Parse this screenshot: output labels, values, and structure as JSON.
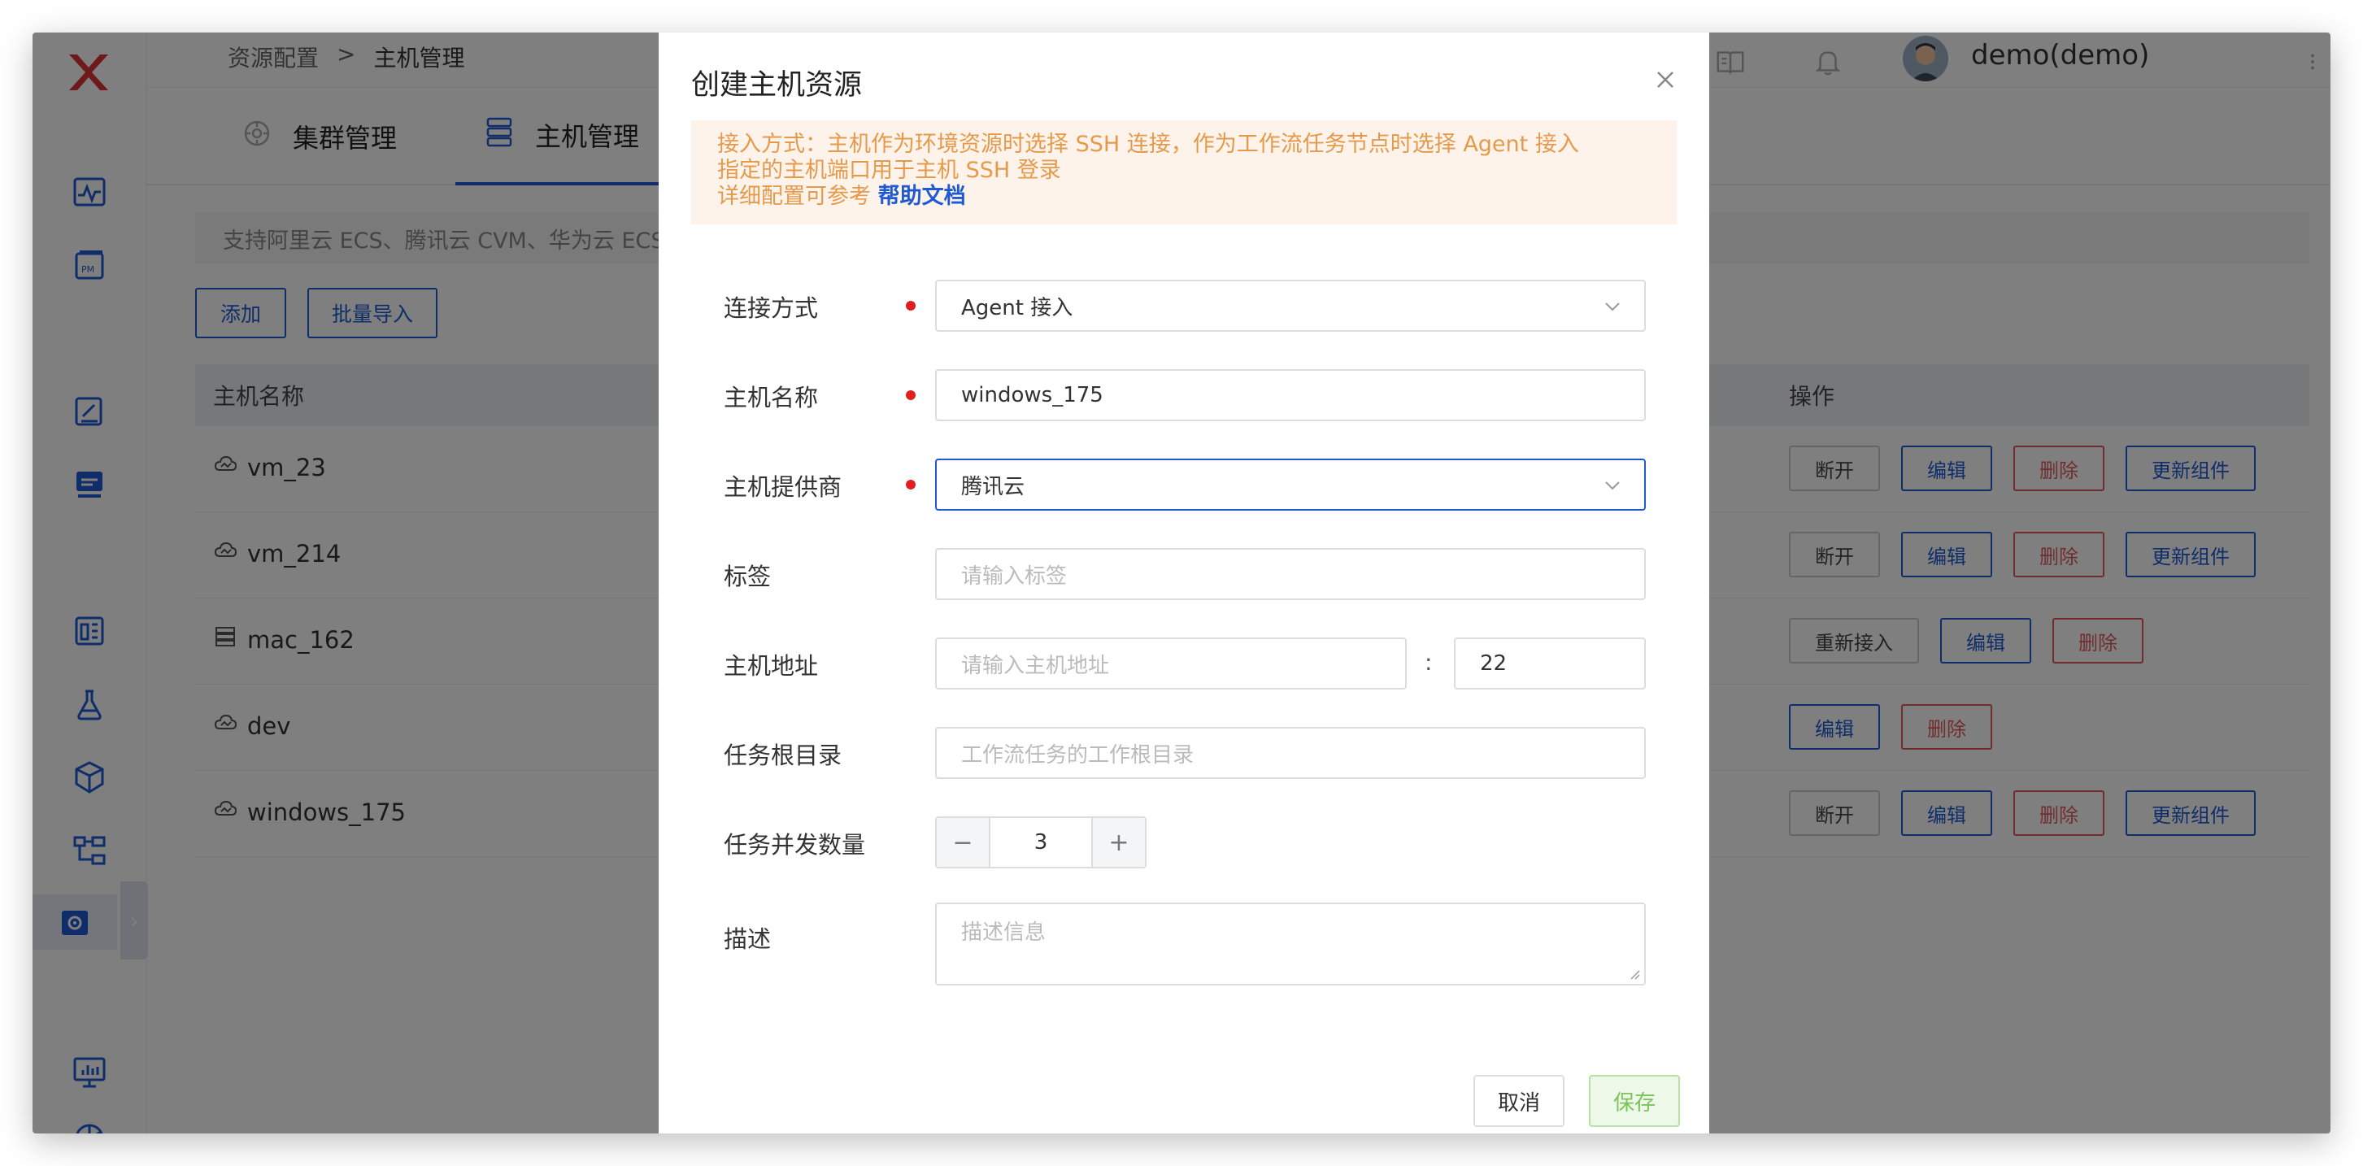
{
  "breadcrumb": {
    "parent": "资源配置",
    "separator": ">",
    "current": "主机管理"
  },
  "user": {
    "name": "demo(demo)"
  },
  "tabs": [
    {
      "label": "集群管理",
      "icon": "cluster-icon"
    },
    {
      "label": "主机管理",
      "icon": "server-icon",
      "active": true
    }
  ],
  "notice": "支持阿里云 ECS、腾讯云 CVM、华为云 ECS",
  "toolbar": {
    "add_label": "添加",
    "import_label": "批量导入"
  },
  "table": {
    "col_name": "主机名称",
    "col_actions": "操作",
    "rows": [
      {
        "name": "vm_23",
        "icon": "cloud-icon",
        "actions": [
          "断开",
          "编辑",
          "删除",
          "更新组件"
        ]
      },
      {
        "name": "vm_214",
        "icon": "cloud-icon",
        "actions": [
          "断开",
          "编辑",
          "删除",
          "更新组件"
        ]
      },
      {
        "name": "mac_162",
        "icon": "server-icon",
        "actions": [
          "重新接入",
          "编辑",
          "删除"
        ]
      },
      {
        "name": "dev",
        "icon": "cloud-icon",
        "actions": [
          "编辑",
          "删除"
        ]
      },
      {
        "name": "windows_175",
        "icon": "cloud-icon",
        "actions": [
          "断开",
          "编辑",
          "删除",
          "更新组件"
        ]
      }
    ]
  },
  "modal": {
    "title": "创建主机资源",
    "alert_line1": "接入方式：主机作为环境资源时选择 SSH 连接，作为工作流任务节点时选择 Agent 接入",
    "alert_line2": "指定的主机端口用于主机 SSH 登录",
    "alert_line3_prefix": "详细配置可参考",
    "alert_link": "帮助文档",
    "fields": {
      "connect": {
        "label": "连接方式",
        "value": "Agent 接入"
      },
      "hostname": {
        "label": "主机名称",
        "value": "windows_175"
      },
      "provider": {
        "label": "主机提供商",
        "value": "腾讯云"
      },
      "tags": {
        "label": "标签",
        "placeholder": "请输入标签"
      },
      "address": {
        "label": "主机地址",
        "placeholder": "请输入主机地址",
        "colon": ":",
        "port": "22"
      },
      "workdir": {
        "label": "任务根目录",
        "placeholder": "工作流任务的工作根目录"
      },
      "concurrency": {
        "label": "任务并发数量",
        "value": "3",
        "minus": "−",
        "plus": "+"
      },
      "desc": {
        "label": "描述",
        "placeholder": "描述信息"
      }
    },
    "cancel_label": "取消",
    "save_label": "保存"
  },
  "colors": {
    "primary": "#1f5ad2",
    "danger": "#e05a5a",
    "warning_text": "#e59a4b",
    "warning_bg": "#fdf3ea",
    "success": "#7cc35c"
  }
}
